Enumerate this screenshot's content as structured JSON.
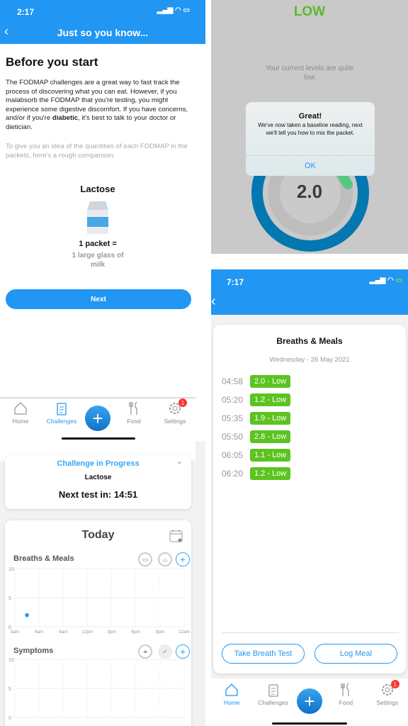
{
  "screen1": {
    "status_time": "2:17",
    "header_title": "Just so you know...",
    "title": "Before you start",
    "para_pre": "The FODMAP challenges are a great way to fast track the process of discovering what you can eat. However, if you malabsorb the FODMAP that you're testing, you might experience some digestive discomfort. If you have concerns, and/or if you're ",
    "para_bold": "diabetic",
    "para_post": ", it's best to talk to your doctor or dietician.",
    "para2": "To give you an idea of the quantities of each FODMAP in the packets, here's a rough comparison:",
    "fodmap": "Lactose",
    "packet": "1 packet =",
    "equivalent": "1 large glass of milk",
    "next": "Next"
  },
  "nav_left": {
    "items": [
      "Home",
      "Challenges",
      "Food",
      "Settings"
    ],
    "badge": "1",
    "active": "Challenges"
  },
  "screen2": {
    "challenge_title": "Challenge in Progress",
    "challenge_name": "Lactose",
    "next_test": "Next test in: 14:51",
    "today": "Today",
    "breaths_title": "Breaths & Meals",
    "symptoms_title": "Symptoms"
  },
  "chart_data": [
    {
      "type": "scatter",
      "title": "Breaths & Meals",
      "x_ticks": [
        "3am",
        "6am",
        "9am",
        "12pm",
        "3pm",
        "6pm",
        "9pm",
        "12am"
      ],
      "y_ticks": [
        "0",
        "5",
        "10"
      ],
      "ylim": [
        0,
        10
      ],
      "points": [
        {
          "x": "4:30am",
          "y": 2.0
        }
      ],
      "color": "#2196f3",
      "grid": true
    },
    {
      "type": "scatter",
      "title": "Symptoms",
      "y_ticks": [
        "0",
        "5",
        "10"
      ],
      "ylim": [
        0,
        10
      ],
      "points": [],
      "grid": true
    }
  ],
  "screen3": {
    "level": "LOW",
    "level_desc": "Your current levels are quite low",
    "reading": "2.0",
    "alert": {
      "title": "Great!",
      "message": "We've now taken a baseline reading, next we'll tell you how to mix the packet.",
      "ok": "OK"
    }
  },
  "screen4": {
    "status_time": "7:17",
    "card_title": "Breaths & Meals",
    "date": "Wednesday - 26 May 2021",
    "readings": [
      {
        "time": "04:58",
        "value": "2.0 - Low"
      },
      {
        "time": "05:20",
        "value": "1.2 - Low"
      },
      {
        "time": "05:35",
        "value": "1.9 - Low"
      },
      {
        "time": "05:50",
        "value": "2.8 - Low"
      },
      {
        "time": "06:05",
        "value": "1.1 - Low"
      },
      {
        "time": "06:20",
        "value": "1.2 - Low"
      }
    ],
    "take_breath": "Take Breath Test",
    "log_meal": "Log Meal"
  },
  "nav_right": {
    "items": [
      "Home",
      "Challenges",
      "Food",
      "Settings"
    ],
    "badge": "1",
    "active": "Home"
  },
  "colors": {
    "accent": "#2196f3",
    "low": "#5cc320",
    "ring": "#0277b0"
  }
}
